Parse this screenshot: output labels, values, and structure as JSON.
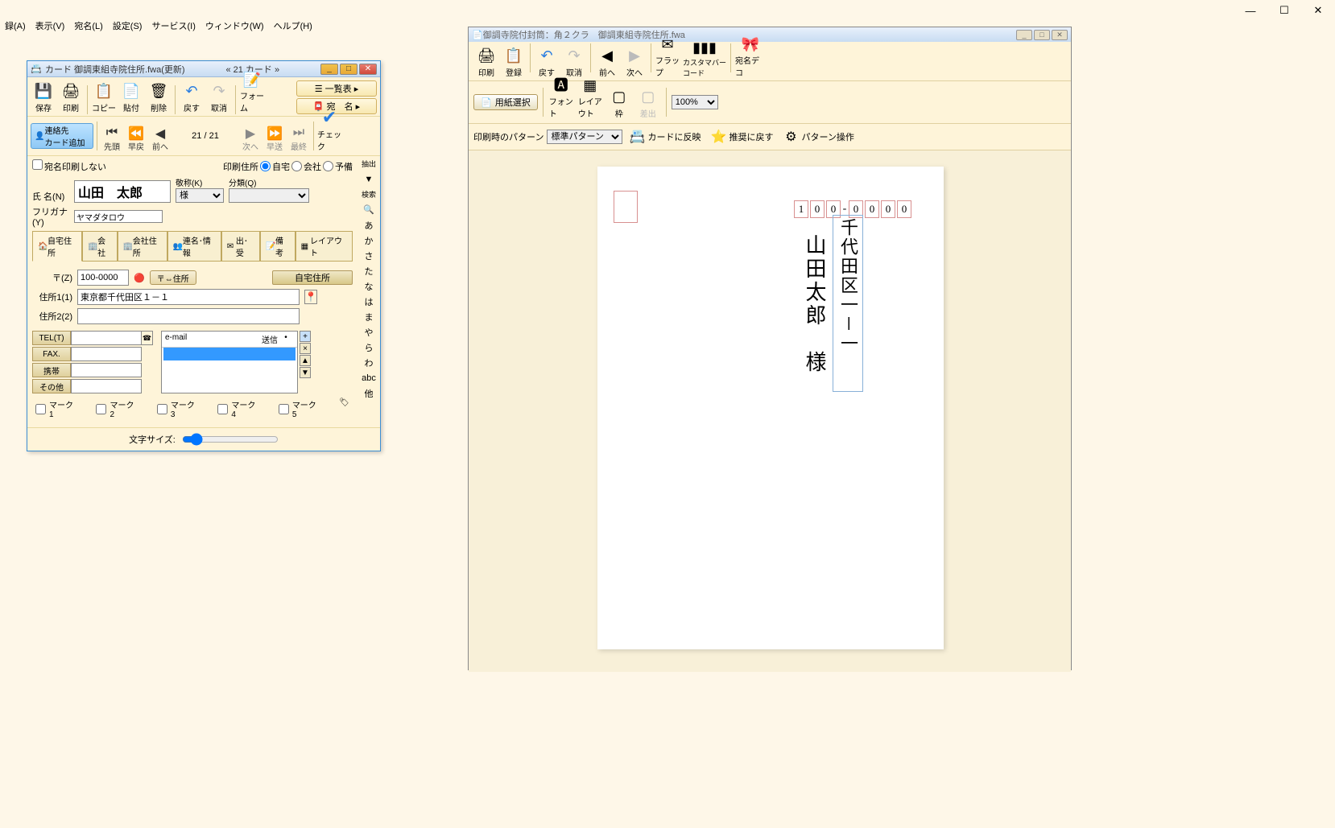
{
  "main_menu": [
    "録(A)",
    "表示(V)",
    "宛名(L)",
    "設定(S)",
    "サービス(I)",
    "ウィンドウ(W)",
    "ヘルプ(H)"
  ],
  "card_window": {
    "title": "カード 御調東組寺院住所.fwa(更新)",
    "title_center": "« 21 カード »",
    "toolbar1": {
      "save": "保存",
      "print": "印刷",
      "copy": "コピー",
      "paste": "貼付",
      "delete": "削除",
      "undo": "戻す",
      "cancel": "取消",
      "form": "フォーム",
      "list": "一覧表",
      "atena": "宛　名"
    },
    "toolbar2": {
      "contact_add": "連絡先\nカード追加",
      "first": "先頭",
      "fastback": "早戻",
      "prev": "前へ",
      "page": "21 /   21",
      "next": "次へ",
      "fastfwd": "早送",
      "last": "最終",
      "check": "チェック"
    },
    "no_print_label": "宛名印刷しない",
    "print_addr_label": "印刷住所",
    "radios": [
      "自宅",
      "会社",
      "予備"
    ],
    "name_label": "氏 名(N)",
    "name_value": "山田　太郎",
    "honorific_label": "敬称(K)",
    "honorific_value": "様",
    "category_label": "分類(Q)",
    "kana_label": "フリガナ(Y)",
    "kana_value": "ヤマダタロウ",
    "tabs": [
      "自宅住所",
      "会社",
      "会社住所",
      "連名･情報",
      "出･受",
      "備考",
      "レイアウト"
    ],
    "postal_label": "〒(Z)",
    "postal_value": "100-0000",
    "postal_btn": "〒⇔住所",
    "home_addr_btn": "自宅住所",
    "addr1_label": "住所1(1)",
    "addr1_value": "東京都千代田区１－１",
    "addr2_label": "住所2(2)",
    "addr2_value": "",
    "tel_labels": [
      "TEL(T)",
      "FAX.",
      "携帯",
      "その他"
    ],
    "email_hdr": "e-mail",
    "send_hdr": "送信",
    "marks": [
      "マーク1",
      "マーク2",
      "マーク3",
      "マーク4",
      "マーク5"
    ],
    "font_size_label": "文字サイズ:",
    "side_index": {
      "extract": "抽出",
      "search": "検索",
      "chars": [
        "あ",
        "か",
        "さ",
        "た",
        "な",
        "は",
        "ま",
        "や",
        "ら",
        "わ",
        "abc",
        "他"
      ]
    }
  },
  "preview_window": {
    "title": "御調寺院付封筒：角２クラ　御調東組寺院住所.fwa",
    "tb1": {
      "print": "印刷",
      "register": "登録",
      "undo": "戻す",
      "cancel": "取消",
      "prev": "前へ",
      "next": "次へ",
      "flap": "フラップ",
      "barcode": "カスタマバーコード",
      "deco": "宛名デコ"
    },
    "tb2": {
      "paper": "用紙選択",
      "font": "フォント",
      "layout": "レイアウト",
      "frame": "枠",
      "diff": "差出",
      "zoom": "100%"
    },
    "tb3": {
      "pattern_label": "印刷時のパターン",
      "pattern_value": "標準パターン",
      "reflect": "カードに反映",
      "recommend": "推奨に戻す",
      "pattern_op": "パターン操作"
    },
    "postal": [
      "1",
      "0",
      "0",
      "-",
      "0",
      "0",
      "0",
      "0"
    ],
    "addr_vertical": "千代田区一－一",
    "name_vertical": "山田太郎　様"
  }
}
